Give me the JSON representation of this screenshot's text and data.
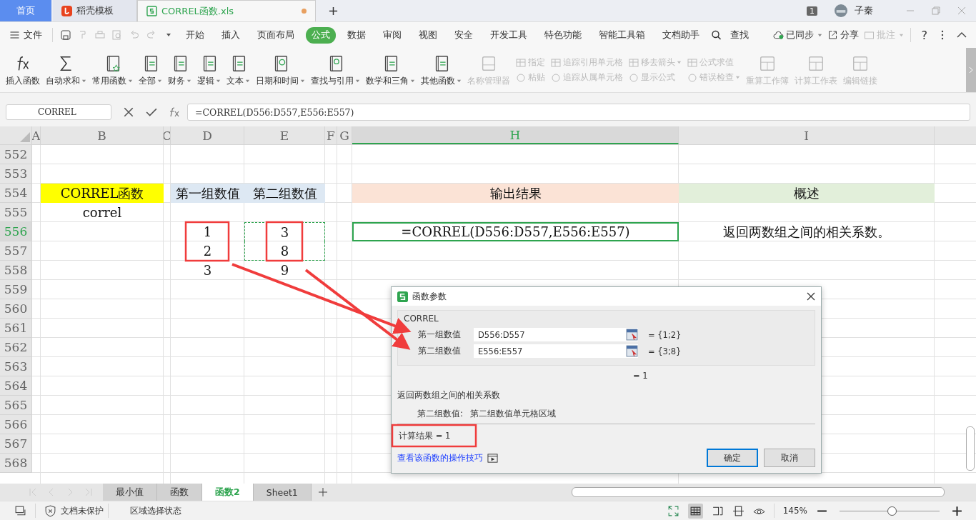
{
  "tabs": [
    {
      "label": "首页",
      "kind": "home",
      "selected": false,
      "modified": false
    },
    {
      "label": "稻壳模板",
      "kind": "docer",
      "selected": false,
      "modified": false
    },
    {
      "label": "CORREL函数.xls",
      "kind": "sheet",
      "selected": true,
      "modified": true
    }
  ],
  "title_bar": {
    "badge": "1",
    "user": "子秦"
  },
  "menu": {
    "file": "文件",
    "tabs": [
      {
        "label": "开始",
        "selected": false
      },
      {
        "label": "插入",
        "selected": false
      },
      {
        "label": "页面布局",
        "selected": false
      },
      {
        "label": "公式",
        "selected": true
      },
      {
        "label": "数据",
        "selected": false
      },
      {
        "label": "审阅",
        "selected": false
      },
      {
        "label": "视图",
        "selected": false
      },
      {
        "label": "安全",
        "selected": false
      },
      {
        "label": "开发工具",
        "selected": false
      },
      {
        "label": "特色功能",
        "selected": false
      },
      {
        "label": "智能工具箱",
        "selected": false
      },
      {
        "label": "文档助手",
        "selected": false
      }
    ],
    "search": "查找",
    "sync": "已同步",
    "share": "分享",
    "comment": {
      "label": "批注",
      "disabled": true
    },
    "help": "?"
  },
  "ribbon": {
    "large": [
      {
        "label": "插入函数",
        "kind": "fx",
        "dropdown": false,
        "disabled": false
      },
      {
        "label": "自动求和",
        "kind": "sigma",
        "dropdown": true,
        "disabled": false
      },
      {
        "label": "常用函数",
        "kind": "star",
        "dropdown": true,
        "disabled": false
      },
      {
        "label": "全部",
        "kind": "book",
        "dropdown": true,
        "disabled": false
      },
      {
        "label": "财务",
        "kind": "book",
        "dropdown": true,
        "disabled": false
      },
      {
        "label": "逻辑",
        "kind": "book",
        "dropdown": true,
        "disabled": false
      },
      {
        "label": "文本",
        "kind": "book",
        "dropdown": true,
        "disabled": false
      },
      {
        "label": "日期和时间",
        "kind": "clock",
        "dropdown": true,
        "disabled": false
      },
      {
        "label": "查找与引用",
        "kind": "lens",
        "dropdown": true,
        "disabled": false
      },
      {
        "label": "数学和三角",
        "kind": "book",
        "dropdown": true,
        "disabled": false
      },
      {
        "label": "其他函数",
        "kind": "book",
        "dropdown": true,
        "disabled": false
      },
      {
        "label": "名称管理器",
        "kind": "tray",
        "dropdown": false,
        "disabled": true
      }
    ],
    "small": [
      {
        "top": {
          "label": "指定",
          "dropdown": false
        },
        "bottom": {
          "label": "粘贴",
          "dropdown": false
        }
      },
      {
        "top": {
          "label": "追踪引用单元格",
          "dropdown": false
        },
        "bottom": {
          "label": "追踪从属单元格",
          "dropdown": false
        }
      },
      {
        "top": {
          "label": "移去箭头",
          "dropdown": true
        },
        "bottom": {
          "label": "显示公式",
          "dropdown": false
        }
      },
      {
        "top": {
          "label": "公式求值",
          "dropdown": false
        },
        "bottom": {
          "label": "错误检查",
          "dropdown": true
        }
      }
    ],
    "large_right": [
      {
        "label": "重算工作簿",
        "disabled": true
      },
      {
        "label": "计算工作表",
        "disabled": true
      },
      {
        "label": "编辑链接",
        "disabled": true
      }
    ]
  },
  "formula_bar": {
    "name_box": "CORREL",
    "formula": "=CORREL(D556:D557,E556:E557)"
  },
  "sheet": {
    "columns": [
      {
        "label": "A",
        "selected": false
      },
      {
        "label": "B",
        "selected": false
      },
      {
        "label": "C",
        "selected": false
      },
      {
        "label": "D",
        "selected": false
      },
      {
        "label": "E",
        "selected": false
      },
      {
        "label": "F",
        "selected": false
      },
      {
        "label": "G",
        "selected": false
      },
      {
        "label": "H",
        "selected": true
      },
      {
        "label": "I",
        "selected": false
      }
    ],
    "rows": [
      {
        "num": "552",
        "selected": false,
        "cells": {}
      },
      {
        "num": "553",
        "selected": false,
        "cells": {}
      },
      {
        "num": "554",
        "selected": false,
        "cells": {
          "B": {
            "text": "CORREL函数",
            "color": "#ffff00"
          },
          "D": {
            "text": "第一组数值",
            "color": "#dde8f3"
          },
          "E": {
            "text": "第二组数值",
            "color": "#dde8f3"
          },
          "H": {
            "text": "输出结果",
            "color": "#fbe3d6"
          },
          "I": {
            "text": "概述",
            "color": "#e2efda"
          }
        }
      },
      {
        "num": "555",
        "selected": false,
        "cells": {
          "B": {
            "text": "correl"
          }
        }
      },
      {
        "num": "556",
        "selected": true,
        "cells": {
          "D": {
            "text": "1"
          },
          "E": {
            "text": "3",
            "marquee": true
          },
          "H": {
            "text": "=CORREL(D556:D557,E556:E557)",
            "selected": true
          },
          "I": {
            "text": "返回两数组之间的相关系数。"
          }
        }
      },
      {
        "num": "557",
        "selected": false,
        "cells": {
          "D": {
            "text": "2"
          },
          "E": {
            "text": "8",
            "marquee": true
          }
        }
      },
      {
        "num": "558",
        "selected": false,
        "cells": {
          "D": {
            "text": "3"
          },
          "E": {
            "text": "9"
          }
        }
      },
      {
        "num": "559",
        "selected": false,
        "cells": {}
      },
      {
        "num": "560",
        "selected": false,
        "cells": {}
      },
      {
        "num": "561",
        "selected": false,
        "cells": {}
      },
      {
        "num": "562",
        "selected": false,
        "cells": {}
      },
      {
        "num": "563",
        "selected": false,
        "cells": {}
      },
      {
        "num": "564",
        "selected": false,
        "cells": {}
      },
      {
        "num": "565",
        "selected": false,
        "cells": {}
      },
      {
        "num": "566",
        "selected": false,
        "cells": {}
      },
      {
        "num": "567",
        "selected": false,
        "cells": {}
      },
      {
        "num": "568",
        "selected": false,
        "cells": {}
      }
    ]
  },
  "dialog": {
    "title": "函数参数",
    "function": "CORREL",
    "args": [
      {
        "label": "第一组数值",
        "value": "D556:D557",
        "result": "= {1;2}"
      },
      {
        "label": "第二组数值",
        "value": "E556:E557",
        "result": "= {3;8}"
      }
    ],
    "total": "= 1",
    "description": "返回两数组之间的相关系数",
    "help_label": "第二组数值:",
    "help_text": "第二组数值单元格区域",
    "calc": "计算结果  =  1",
    "link": "查看该函数的操作技巧",
    "buttons": [
      {
        "label": "确定",
        "kind": "primary"
      },
      {
        "label": "取消",
        "kind": "normal"
      }
    ]
  },
  "sheet_tabs": [
    {
      "label": "最小值",
      "selected": false
    },
    {
      "label": "函数",
      "selected": false
    },
    {
      "label": "函数2",
      "selected": true
    },
    {
      "label": "Sheet1",
      "selected": false
    }
  ],
  "status_bar": {
    "protection": "文档未保护",
    "mode": "区域选择状态",
    "zoom": "145%",
    "zoom_slider": {
      "level": 0.52
    }
  }
}
